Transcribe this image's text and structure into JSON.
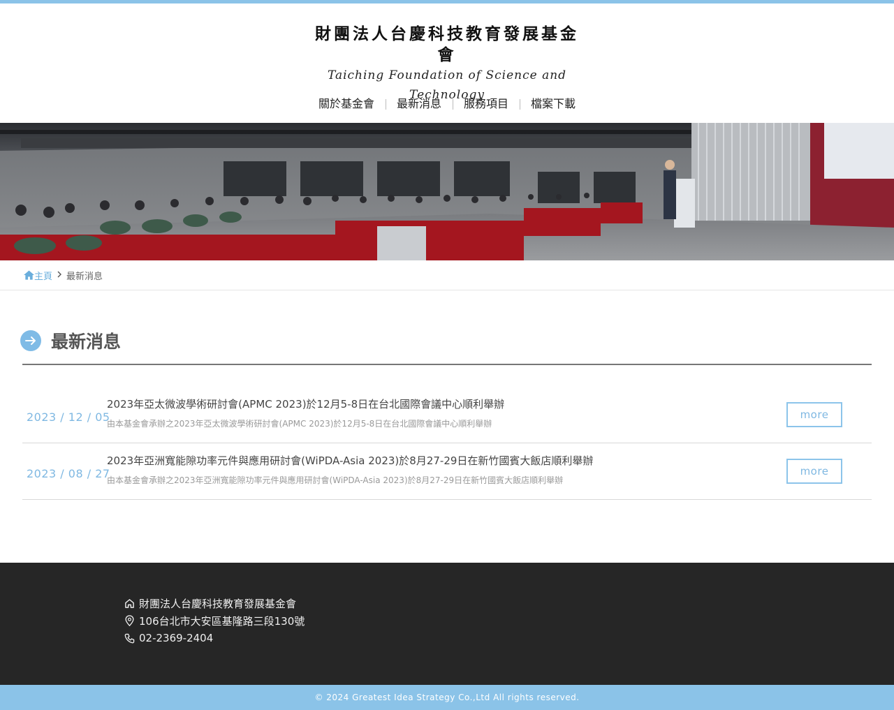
{
  "header": {
    "logo_zh": "財團法人台慶科技教育發展基金會",
    "logo_en": "Taiching Foundation of Science and Technology",
    "accent_color": "#8bc3e8"
  },
  "nav": {
    "items": [
      {
        "label": "關於基金會"
      },
      {
        "label": "最新消息"
      },
      {
        "label": "服務項目"
      },
      {
        "label": "檔案下載"
      }
    ]
  },
  "hero": {
    "icon": "conference-photo"
  },
  "breadcrumb": {
    "home": "主頁",
    "current": "最新消息"
  },
  "section": {
    "title": "最新消息"
  },
  "news": [
    {
      "date": "2023 / 12 / 05",
      "title": "2023年亞太微波學術研討會(APMC 2023)於12月5-8日在台北國際會議中心順利舉辦",
      "desc": "由本基金會承辦之2023年亞太微波學術研討會(APMC 2023)於12月5-8日在台北國際會議中心順利舉辦",
      "more": "more"
    },
    {
      "date": "2023 / 08 / 27",
      "title": "2023年亞洲寬能隙功率元件與應用研討會(WiPDA-Asia 2023)於8月27-29日在新竹國賓大飯店順利舉辦",
      "desc": "由本基金會承辦之2023年亞洲寬能隙功率元件與應用研討會(WiPDA-Asia 2023)於8月27-29日在新竹國賓大飯店順利舉辦",
      "more": "more"
    }
  ],
  "footer": {
    "name": "財團法人台慶科技教育發展基金會",
    "address": "106台北市大安區基隆路三段130號",
    "phone": "02-2369-2404",
    "copyright": "© 2024 Greatest Idea Strategy Co.,Ltd All rights reserved."
  }
}
